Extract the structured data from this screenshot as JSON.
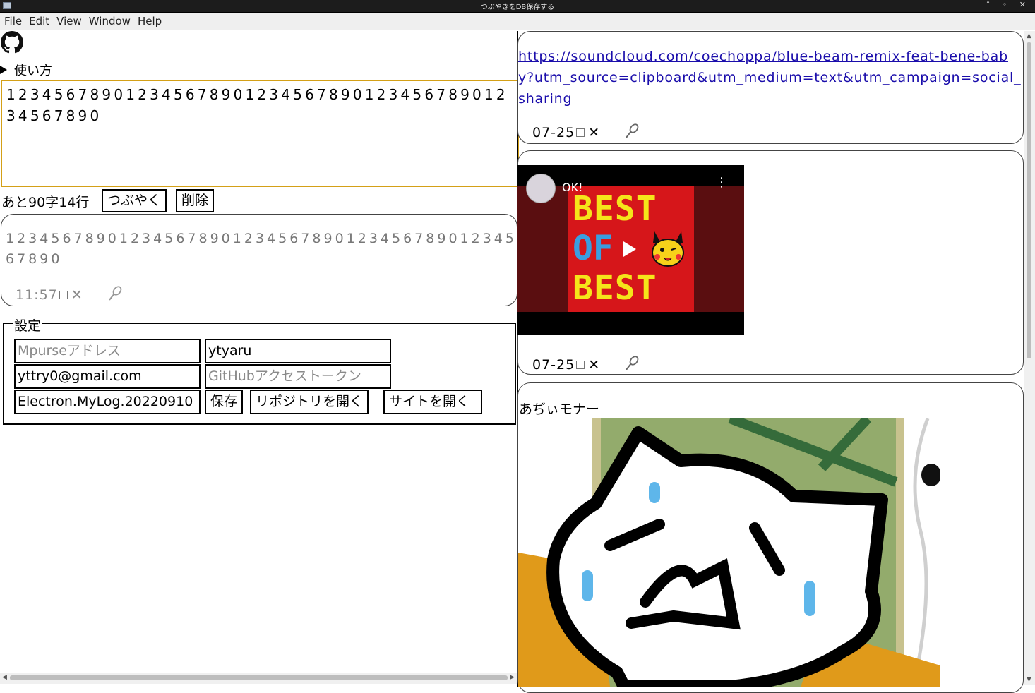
{
  "window": {
    "title": "つぶやきをDB保存する",
    "controls": "˄ ◦ ✕"
  },
  "menu": [
    "File",
    "Edit",
    "View",
    "Window",
    "Help"
  ],
  "howto_label": "使い方",
  "composer": {
    "text": "12345678901234567890123456789012345678901234567890"
  },
  "counter": "あと90字14行",
  "buttons": {
    "tweet": "つぶやく",
    "delete": "削除"
  },
  "preview": {
    "text": "12345678901234567890123456789012345678901234567890",
    "time": "11:57",
    "delete_glyph": "✕"
  },
  "settings": {
    "legend": "設定",
    "mpurse_placeholder": "Mpurseアドレス",
    "username": "ytyaru",
    "email": "yttry0@gmail.com",
    "github_token_placeholder": "GitHubアクセストークン",
    "repo": "Electron.MyLog.20220910",
    "save": "保存",
    "open_repo": "リポジトリを開く",
    "open_site": "サイトを開く"
  },
  "posts": [
    {
      "link": "https://soundcloud.com/coechoppa/blue-beam-remix-feat-bene-baby?utm_source=clipboard&utm_medium=text&utm_campaign=social_sharing",
      "date": "07-25"
    },
    {
      "video": {
        "title": "OK!",
        "art_line1": "BEST",
        "art_line2": "OF",
        "art_line3": "BEST"
      },
      "date": "07-25"
    },
    {
      "text": "あぢぃモナー"
    }
  ],
  "colors": {
    "focus_border": "#d4a017",
    "link": "#1a0dab",
    "drawing_green": "#93ab6c",
    "drawing_orange": "#e09a1a"
  }
}
